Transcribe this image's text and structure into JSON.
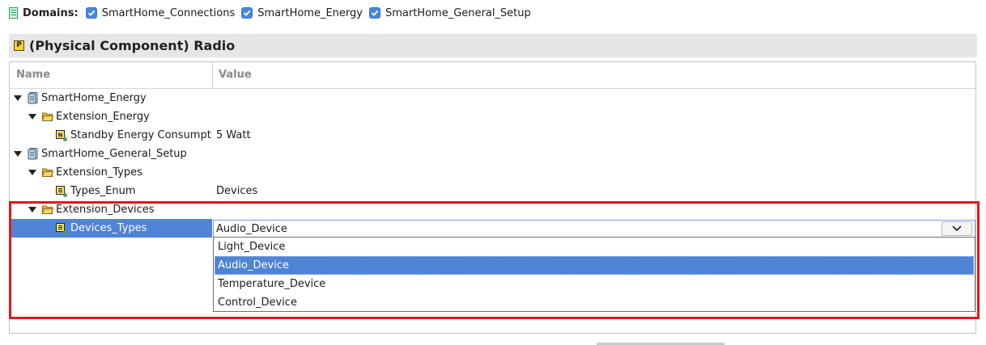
{
  "domains": {
    "label": "Domains:",
    "items": [
      {
        "label": "SmartHome_Connections",
        "checked": true
      },
      {
        "label": "SmartHome_Energy",
        "checked": true
      },
      {
        "label": "SmartHome_General_Setup",
        "checked": true
      }
    ]
  },
  "header": {
    "icon_letter": "P",
    "title": "(Physical Component) Radio"
  },
  "table": {
    "columns": {
      "name": "Name",
      "value": "Value"
    },
    "rows": [
      {
        "name": "SmartHome_Energy",
        "value": ""
      },
      {
        "name": "Extension_Energy",
        "value": ""
      },
      {
        "name": "Standby Energy Consumption",
        "value": "5 Watt"
      },
      {
        "name": "SmartHome_General_Setup",
        "value": ""
      },
      {
        "name": "Extension_Types",
        "value": ""
      },
      {
        "name": "Types_Enum",
        "value": "Devices"
      },
      {
        "name": "Extension_Devices",
        "value": ""
      },
      {
        "name": "Devices_Types",
        "value": "Audio_Device"
      }
    ]
  },
  "dropdown": {
    "selected": "Audio_Device",
    "options": [
      "Light_Device",
      "Audio_Device",
      "Temperature_Device",
      "Control_Device"
    ]
  },
  "colors": {
    "accent": "#4f83d6",
    "highlight": "#e8141b",
    "folder": "#f2c544"
  }
}
